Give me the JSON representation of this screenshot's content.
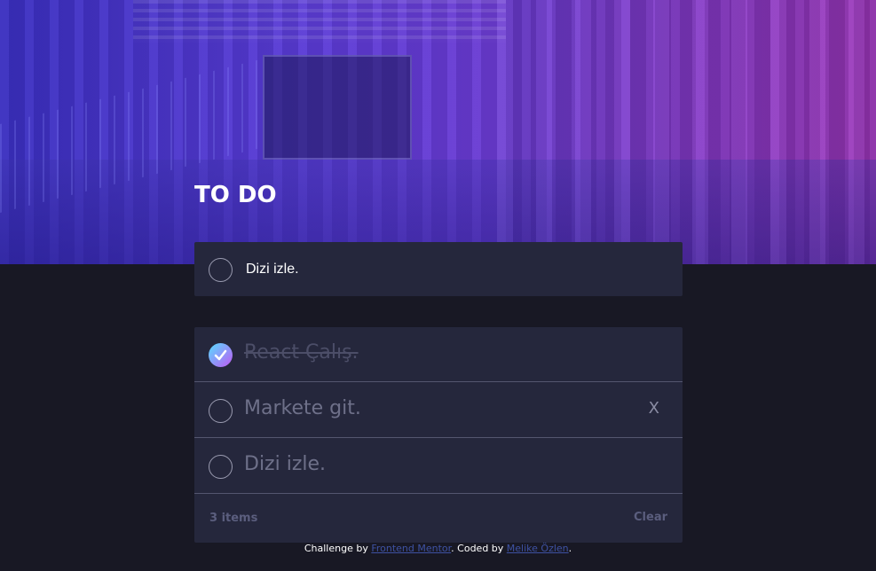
{
  "header": {
    "title": "TO DO"
  },
  "new_todo": {
    "value": "Dizi izle."
  },
  "todos": [
    {
      "label": "React Çalış.",
      "completed": true
    },
    {
      "label": "Markete git.",
      "completed": false,
      "delete_label": "X"
    },
    {
      "label": "Dizi izle.",
      "completed": false
    }
  ],
  "footer": {
    "items_left": "3 items",
    "clear_label": "Clear"
  },
  "attribution": {
    "prefix": "Challenge by ",
    "link1": "Frontend Mentor",
    "middle": ". Coded by ",
    "link2": "Melike Özlen",
    "suffix": "."
  },
  "colors": {
    "background": "#181824",
    "card": "#25273c",
    "check_gradient_start": "#57ddff",
    "check_gradient_end": "#c058f3",
    "link": "#3e52a3"
  },
  "icons": {
    "check": "check-icon",
    "circle": "circle-icon"
  }
}
